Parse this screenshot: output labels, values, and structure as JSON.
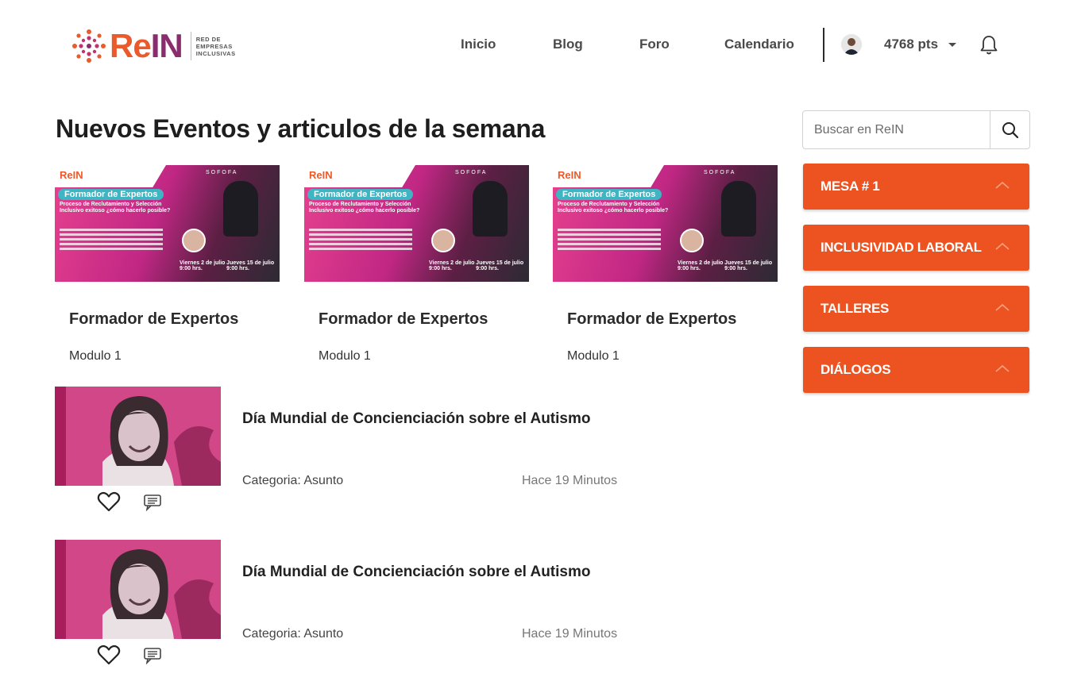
{
  "brand": {
    "logo_text": "ReIN",
    "logo_subtitle": [
      "RED DE",
      "EMPRESAS",
      "INCLUSIVAS"
    ],
    "colors": {
      "orange": "#ea5a2a",
      "purple": "#8a2c6e"
    }
  },
  "nav": {
    "items": [
      {
        "label": "Inicio"
      },
      {
        "label": "Blog"
      },
      {
        "label": "Foro"
      },
      {
        "label": "Calendario"
      }
    ],
    "points": "4768 pts",
    "avatar_icon": "user-avatar",
    "notification_icon": "bell-icon"
  },
  "main": {
    "title": "Nuevos Eventos y articulos de la semana",
    "event_cards": [
      {
        "title": "Formador de Expertos",
        "subtitle": "Modulo 1",
        "image_text": {
          "logo": "ReIN",
          "org": "SOFOFA",
          "pill": "Formador de Expertos",
          "heading": "Proceso de Reclutamiento y Selección Inclusivo exitoso ¿cómo hacerlo posible?",
          "date1": "Viernes 2 de julio 9:00 hrs.",
          "date2": "Jueves 15 de julio 9:00 hrs."
        }
      },
      {
        "title": "Formador de Expertos",
        "subtitle": "Modulo 1",
        "image_text": {
          "logo": "ReIN",
          "org": "SOFOFA",
          "pill": "Formador de Expertos",
          "heading": "Proceso de Reclutamiento y Selección Inclusivo exitoso ¿cómo hacerlo posible?",
          "date1": "Viernes 2 de julio 9:00 hrs.",
          "date2": "Jueves 15 de julio 9:00 hrs."
        }
      },
      {
        "title": "Formador de Expertos",
        "subtitle": "Modulo 1",
        "image_text": {
          "logo": "ReIN",
          "org": "SOFOFA",
          "pill": "Formador de Expertos",
          "heading": "Proceso de Reclutamiento y Selección Inclusivo exitoso ¿cómo hacerlo posible?",
          "date1": "Viernes 2 de julio 9:00 hrs.",
          "date2": "Jueves 15 de julio 9:00 hrs."
        }
      }
    ],
    "articles": [
      {
        "title": "Día Mundial de Concienciación sobre el Autismo",
        "category": "Categoria: Asunto",
        "time": "Hace 19 Minutos",
        "like_icon": "heart-icon",
        "comment_icon": "comment-icon"
      },
      {
        "title": "Día Mundial de Concienciación sobre el Autismo",
        "category": "Categoria: Asunto",
        "time": "Hace 19 Minutos",
        "like_icon": "heart-icon",
        "comment_icon": "comment-icon"
      }
    ]
  },
  "sidebar": {
    "search": {
      "placeholder": "Buscar en ReIN",
      "icon": "search-icon"
    },
    "accordions": [
      {
        "label": "MESA # 1",
        "icon": "chevron-up-icon"
      },
      {
        "label": "INCLUSIVIDAD LABORAL",
        "icon": "chevron-up-icon"
      },
      {
        "label": "TALLERES",
        "icon": "chevron-up-icon"
      },
      {
        "label": "DIÁLOGOS",
        "icon": "chevron-up-icon"
      }
    ],
    "accent_color": "#ec5320"
  }
}
